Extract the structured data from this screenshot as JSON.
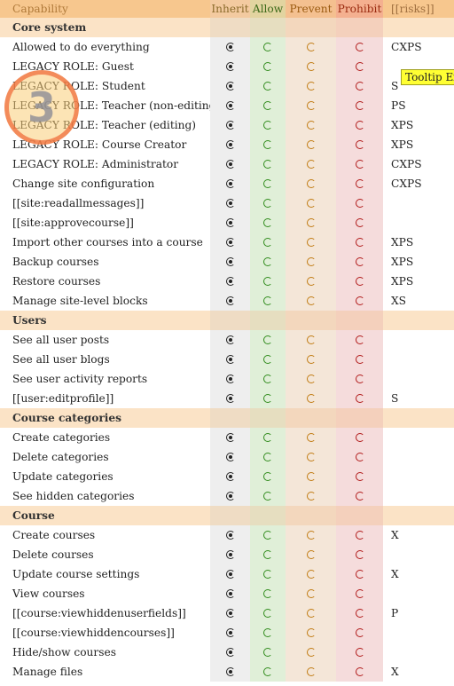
{
  "columns": {
    "capability": "Capability",
    "inherit": "Inherit",
    "allow": "Allow",
    "prevent": "Prevent",
    "prohibit": "Prohibit",
    "risks": "[[risks]]"
  },
  "sections": [
    {
      "title": "Core system",
      "rows": [
        {
          "label": "Allowed to do everything",
          "risks": "CXPS"
        },
        {
          "label": "LEGACY ROLE: Guest",
          "risks": ""
        },
        {
          "label": "LEGACY ROLE: Student",
          "risks": "S"
        },
        {
          "label": "LEGACY ROLE: Teacher (non-editing)",
          "risks": "PS"
        },
        {
          "label": "LEGACY ROLE: Teacher (editing)",
          "risks": "XPS"
        },
        {
          "label": "LEGACY ROLE: Course Creator",
          "risks": "XPS"
        },
        {
          "label": "LEGACY ROLE: Administrator",
          "risks": "CXPS"
        },
        {
          "label": "Change site configuration",
          "risks": "CXPS"
        },
        {
          "label": "[[site:readallmessages]]",
          "risks": ""
        },
        {
          "label": "[[site:approvecourse]]",
          "risks": ""
        },
        {
          "label": "Import other courses into a course",
          "risks": "XPS"
        },
        {
          "label": "Backup courses",
          "risks": "XPS"
        },
        {
          "label": "Restore courses",
          "risks": "XPS"
        },
        {
          "label": "Manage site-level blocks",
          "risks": "XS"
        }
      ]
    },
    {
      "title": "Users",
      "rows": [
        {
          "label": "See all user posts",
          "risks": ""
        },
        {
          "label": "See all user blogs",
          "risks": ""
        },
        {
          "label": "See user activity reports",
          "risks": ""
        },
        {
          "label": "[[user:editprofile]]",
          "risks": "S"
        }
      ]
    },
    {
      "title": "Course categories",
      "rows": [
        {
          "label": "Create categories",
          "risks": ""
        },
        {
          "label": "Delete categories",
          "risks": ""
        },
        {
          "label": "Update categories",
          "risks": ""
        },
        {
          "label": "See hidden categories",
          "risks": ""
        }
      ]
    },
    {
      "title": "Course",
      "rows": [
        {
          "label": "Create courses",
          "risks": "X"
        },
        {
          "label": "Delete courses",
          "risks": ""
        },
        {
          "label": "Update course settings",
          "risks": "X"
        },
        {
          "label": "View courses",
          "risks": ""
        },
        {
          "label": "[[course:viewhiddenuserfields]]",
          "risks": "P"
        },
        {
          "label": "[[course:viewhiddencourses]]",
          "risks": ""
        },
        {
          "label": "Hide/show courses",
          "risks": ""
        },
        {
          "label": "Manage files",
          "risks": "X"
        }
      ]
    }
  ],
  "selected_permission": "inherit",
  "tooltip": "Tooltip Ex",
  "step_badge": "3",
  "colors": {
    "header_bg": "#f7c78e",
    "section_bg": "#fbe3c6",
    "inherit_col": "#eeeeee",
    "allow_col": "#e0efd8",
    "prevent_col": "#f4e6d8",
    "prohibit_col": "#f5dcdc",
    "tooltip_bg": "#ffff33"
  }
}
